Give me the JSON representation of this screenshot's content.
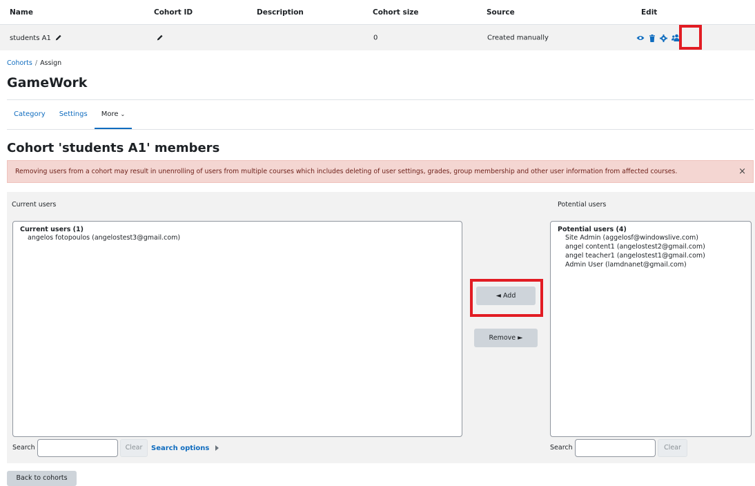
{
  "table": {
    "headers": [
      "Name",
      "Cohort ID",
      "Description",
      "Cohort size",
      "Source",
      "Edit"
    ],
    "row": {
      "name": "students A1",
      "size": "0",
      "source": "Created manually"
    }
  },
  "breadcrumb": {
    "link": "Cohorts",
    "separator": "/",
    "current": "Assign"
  },
  "site_title": "GameWork",
  "nav": {
    "tabs": [
      "Category",
      "Settings"
    ],
    "more_label": "More",
    "more_chevron": "⌄"
  },
  "page_heading": "Cohort 'students A1' members",
  "alert": {
    "message": "Removing users from a cohort may result in unenrolling of users from multiple courses which includes deleting of user settings, grades, group membership and other user information from affected courses.",
    "close": "×"
  },
  "current": {
    "label": "Current users",
    "group_label": "Current users (1)",
    "users": [
      "angelos fotopoulos (angelostest3@gmail.com)"
    ]
  },
  "potential": {
    "label": "Potential users",
    "group_label": "Potential users (4)",
    "users": [
      "Site Admin (aggelosf@windowslive.com)",
      "angel content1 (angelostest2@gmail.com)",
      "angel teacher1 (angelostest1@gmail.com)",
      "Admin User (lamdnanet@gmail.com)"
    ]
  },
  "buttons": {
    "add": "◄ Add",
    "remove": "Remove ►",
    "clear": "Clear",
    "search_options": "Search options",
    "back": "Back to cohorts"
  },
  "search_label": "Search",
  "colors": {
    "link": "#0f6cbf",
    "highlight": "#e21c23",
    "alert_bg": "#f4d6d2"
  },
  "icons": [
    "pencil-icon",
    "eye-icon",
    "trash-icon",
    "gear-icon",
    "users-icon",
    "caret-right-icon"
  ]
}
